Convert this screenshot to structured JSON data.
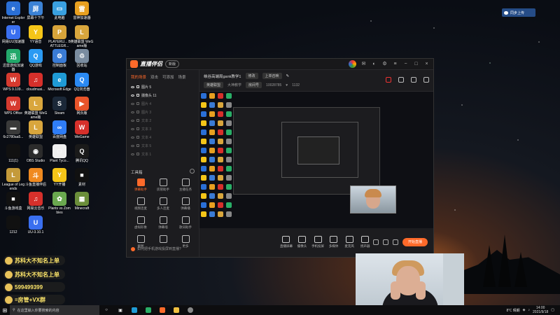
{
  "desktop": {
    "icons": [
      {
        "label": "Internet Explorer",
        "color": "#2a6fd6",
        "glyph": "e"
      },
      {
        "label": "屏幕十下午",
        "color": "#3b82d6",
        "glyph": "屏"
      },
      {
        "label": "此电脑",
        "color": "#3aa0e0",
        "glyph": "▭"
      },
      {
        "label": "雷神加速器",
        "color": "#e8a020",
        "glyph": "雷"
      },
      {
        "label": "网易UU加速器",
        "color": "#3a6ff0",
        "glyph": "U"
      },
      {
        "label": "YY语音",
        "color": "#f5c518",
        "glyph": "Y"
      },
      {
        "label": "PLAYERU... BATTLEGR...",
        "color": "#d8a43a",
        "glyph": "P"
      },
      {
        "label": "英雄联盟 WeGame版",
        "color": "#d9a63d",
        "glyph": "L"
      },
      {
        "label": "迅雷游戏加速器",
        "color": "#23a86b",
        "glyph": "迅"
      },
      {
        "label": "QQ游戏",
        "color": "#2b9af3",
        "glyph": "Q"
      },
      {
        "label": "控制面板",
        "color": "#3a7bd5",
        "glyph": "⚙"
      },
      {
        "label": "回收站",
        "color": "#7a8ca0",
        "glyph": "♲"
      },
      {
        "label": "WPS 9.109...",
        "color": "#d63a2f",
        "glyph": "W"
      },
      {
        "label": "cloudmusi...",
        "color": "#d6302b",
        "glyph": "♫"
      },
      {
        "label": "Microsoft Edge",
        "color": "#1f9bd6",
        "glyph": "e"
      },
      {
        "label": "QQ浏览器",
        "color": "#2b8af3",
        "glyph": "Q"
      },
      {
        "label": "WPS Office",
        "color": "#d63a2f",
        "glyph": "W"
      },
      {
        "label": "英雄联盟 WeGame版",
        "color": "#d9a63d",
        "glyph": "L"
      },
      {
        "label": "Steam",
        "color": "#1b2838",
        "glyph": "S"
      },
      {
        "label": "网页版",
        "color": "#e8542a",
        "glyph": "▶"
      },
      {
        "label": "6c2780aa5...",
        "color": "#3a3a3a",
        "glyph": "▬"
      },
      {
        "label": "英雄联盟",
        "color": "#d9a63d",
        "glyph": "L"
      },
      {
        "label": "百度网盘",
        "color": "#2f7df6",
        "glyph": "∞"
      },
      {
        "label": "WeGame",
        "color": "#d6302b",
        "glyph": "W"
      },
      {
        "label": "111(1)",
        "color": "#111111",
        "glyph": ""
      },
      {
        "label": "OBS Studio",
        "color": "#2b2b2b",
        "glyph": "◉"
      },
      {
        "label": "Plant Tyco...",
        "color": "#f0f0f0",
        "glyph": "□"
      },
      {
        "label": "腾讯QQ",
        "color": "#1a1a1a",
        "glyph": "Q"
      },
      {
        "label": "League of Legends",
        "color": "#c49a3a",
        "glyph": "L"
      },
      {
        "label": "斗鱼直播伴侣",
        "color": "#f08a20",
        "glyph": "斗"
      },
      {
        "label": "YY开播",
        "color": "#f5c518",
        "glyph": "Y"
      },
      {
        "label": "素材",
        "color": "#111111",
        "glyph": "■"
      },
      {
        "label": "斗鱼游戏盒",
        "color": "#111111",
        "glyph": "■"
      },
      {
        "label": "网易云音乐",
        "color": "#d6302b",
        "glyph": "♫"
      },
      {
        "label": "Plants vs Zombies",
        "color": "#6aa84f",
        "glyph": "✿"
      },
      {
        "label": "Minecraft",
        "color": "#6b8e3a",
        "glyph": "▦"
      },
      {
        "label": "1212",
        "color": "#111111",
        "glyph": ""
      },
      {
        "label": "UU-3.10.1",
        "color": "#3a6ff0",
        "glyph": "U"
      }
    ]
  },
  "overlay": {
    "lines": [
      "苏科大不知名上单",
      "苏科大不知名上单",
      "599499399",
      "=房管+VX群"
    ]
  },
  "cloud_widget": {
    "label": "同步上传"
  },
  "app": {
    "title": "直播伴侣",
    "version_badge": "新版",
    "left_tabs": [
      "我的场景",
      "双击",
      "可添加",
      "场景"
    ],
    "sources": [
      {
        "label": "图片 5",
        "on": true
      },
      {
        "label": "摄像头 11",
        "on": true
      },
      {
        "label": "图片 4",
        "on": false
      },
      {
        "label": "图片 3",
        "on": false
      },
      {
        "label": "文本 2",
        "on": false
      },
      {
        "label": "文本 3",
        "on": false
      },
      {
        "label": "文本 4",
        "on": false
      },
      {
        "label": "文本 5",
        "on": false
      },
      {
        "label": "文本 1",
        "on": false
      }
    ],
    "tools_title": "工具箱",
    "tools": [
      {
        "label": "弹幕助手",
        "hot": true
      },
      {
        "label": "房管助手",
        "hot": false
      },
      {
        "label": "主播任务",
        "hot": false
      },
      {
        "label": "视频连麦",
        "hot": false
      },
      {
        "label": "多人连麦",
        "hot": false
      },
      {
        "label": "弹幕播",
        "hot": false
      },
      {
        "label": "虚拟形象",
        "hot": false
      },
      {
        "label": "弹幕墙",
        "hot": false
      },
      {
        "label": "歌词助手",
        "hot": false
      },
      {
        "label": "截图",
        "hot": false
      },
      {
        "label": "",
        "hot": false
      },
      {
        "label": "更多",
        "hot": false
      }
    ],
    "bottom_tip": "如何把手机游戏投屏到直播?",
    "stream_title": "峡谷高端局gank教学1",
    "modify_label": "修改",
    "category": "上单召唤",
    "tags": [
      "英雄联盟",
      "大神教学"
    ],
    "room_label": "房间号",
    "room_number": "10028785",
    "fans_count": "1132",
    "controls": [
      "直播屏幕",
      "摄像头",
      "手机投屏",
      "多媒体",
      "麦克风",
      "扬声器"
    ],
    "go_live": "开始直播"
  },
  "taskbar": {
    "search_placeholder": "在这里输入你要搜索的内容",
    "tray_text": "8℃ 晴朗",
    "time": "14:00",
    "date": "2021/9/18"
  }
}
